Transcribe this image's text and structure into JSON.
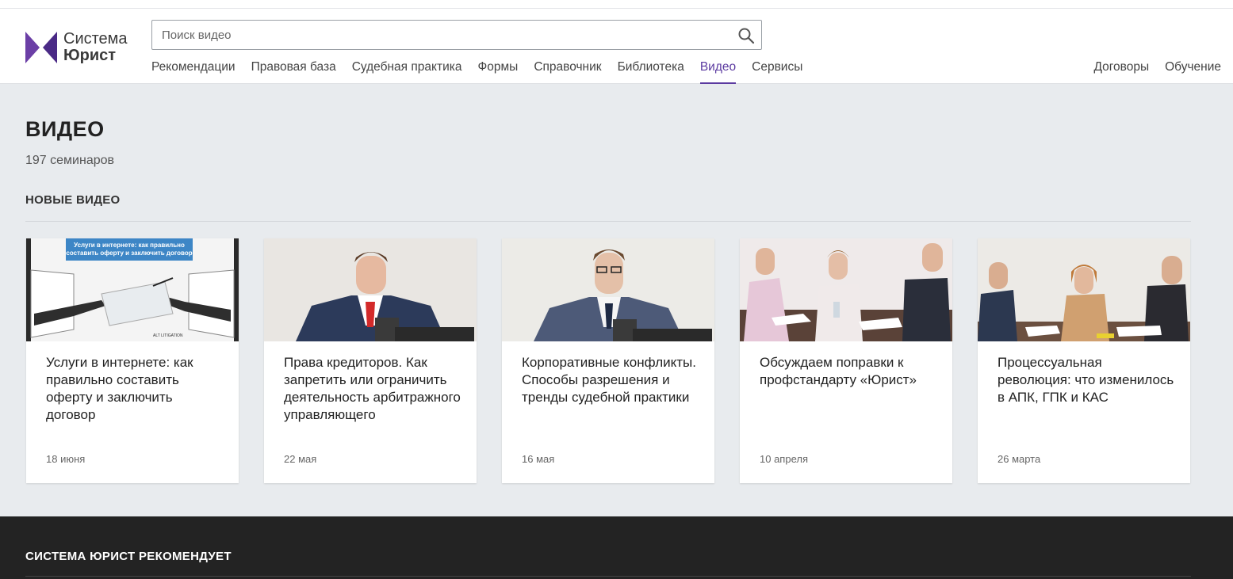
{
  "brand": {
    "line1": "Система",
    "line2": "Юрист",
    "accent": "#5b3aa0"
  },
  "search": {
    "placeholder": "Поиск видео",
    "value": "",
    "icon": "search-icon"
  },
  "nav": {
    "main": [
      {
        "label": "Рекомендации"
      },
      {
        "label": "Правовая база"
      },
      {
        "label": "Судебная практика"
      },
      {
        "label": "Формы"
      },
      {
        "label": "Справочник"
      },
      {
        "label": "Библиотека"
      },
      {
        "label": "Видео",
        "active": true
      },
      {
        "label": "Сервисы"
      }
    ],
    "right": [
      {
        "label": "Договоры"
      },
      {
        "label": "Обучение"
      }
    ]
  },
  "page": {
    "title": "ВИДЕО",
    "count": "197 семинаров",
    "section_title": "НОВЫЕ ВИДЕО"
  },
  "cards": [
    {
      "title": "Услуги в интернете: как правильно составить оферту и заключить договор",
      "date": "18 июня",
      "thumb_banner": "Услуги в интернете: как правильно составить оферту и заключить договор"
    },
    {
      "title": "Права кредиторов. Как запретить или ограничить деятельность арбитражного управляющего",
      "date": "22 мая"
    },
    {
      "title": "Корпоративные конфликты. Способы разрешения и тренды судебной практики",
      "date": "16 мая"
    },
    {
      "title": "Обсуждаем поправки к профстандарту «Юрист»",
      "date": "10 апреля"
    },
    {
      "title": "Процессуальная революция: что изменилось в АПК, ГПК и КАС",
      "date": "26 марта"
    }
  ],
  "footer": {
    "title": "СИСТЕМА ЮРИСТ РЕКОМЕНДУЕТ"
  }
}
